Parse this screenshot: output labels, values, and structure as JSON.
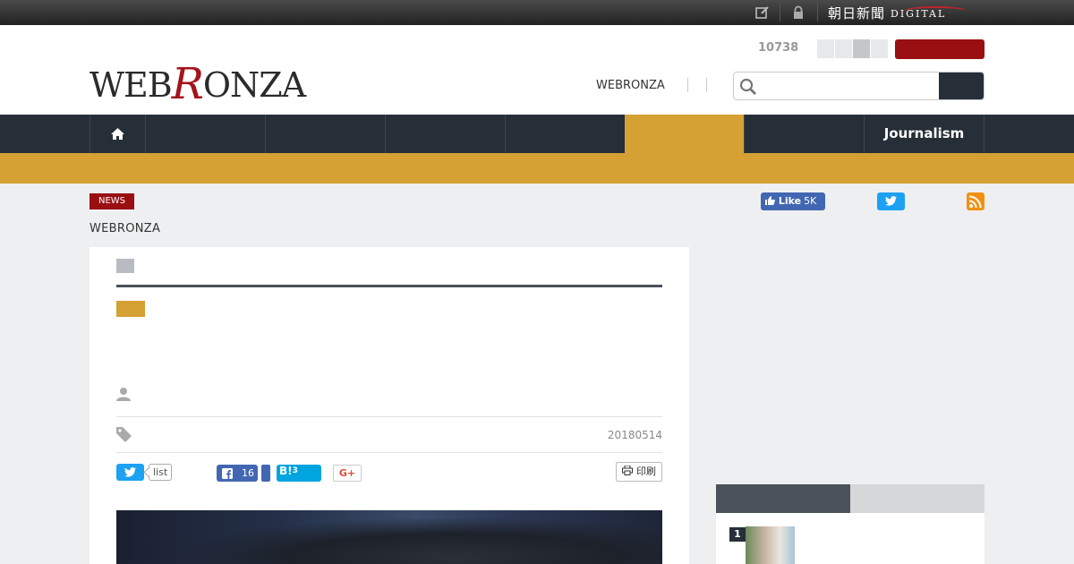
{
  "topbar": {
    "brand": "朝日新聞",
    "brand_suffix": "DIGITAL"
  },
  "header": {
    "logo_pre": "WEB",
    "logo_r": "R",
    "logo_post": "ONZA",
    "count": "10738",
    "link_label": "WEBRONZA",
    "search": {
      "value": "",
      "placeholder": ""
    }
  },
  "nav": {
    "journalism_label": "Journalism"
  },
  "article": {
    "badge": "NEWS",
    "breadcrumb": "WEBRONZA",
    "date": "20180514",
    "share": {
      "list_label": "list",
      "fb_count": "16",
      "hatena_label": "B!",
      "hatena_count": "3",
      "gplus_label": "G+",
      "print_label": "印刷"
    }
  },
  "social": {
    "fb_like_label": "Like",
    "fb_like_count": "5K"
  },
  "ranking": {
    "first_rank": "1"
  },
  "colors": {
    "brand_red": "#9a0f12",
    "nav_dark": "#262f38",
    "accent_gold": "#d5a034",
    "twitter_blue": "#1da1f2",
    "facebook_blue": "#4267b2",
    "hatena_blue": "#00a4de",
    "rss_orange": "#f29111"
  },
  "icons": [
    "edit-icon",
    "lock-icon",
    "search-icon",
    "home-icon",
    "twitter-icon",
    "rss-icon",
    "user-icon",
    "tag-icon",
    "facebook-icon",
    "printer-icon"
  ]
}
